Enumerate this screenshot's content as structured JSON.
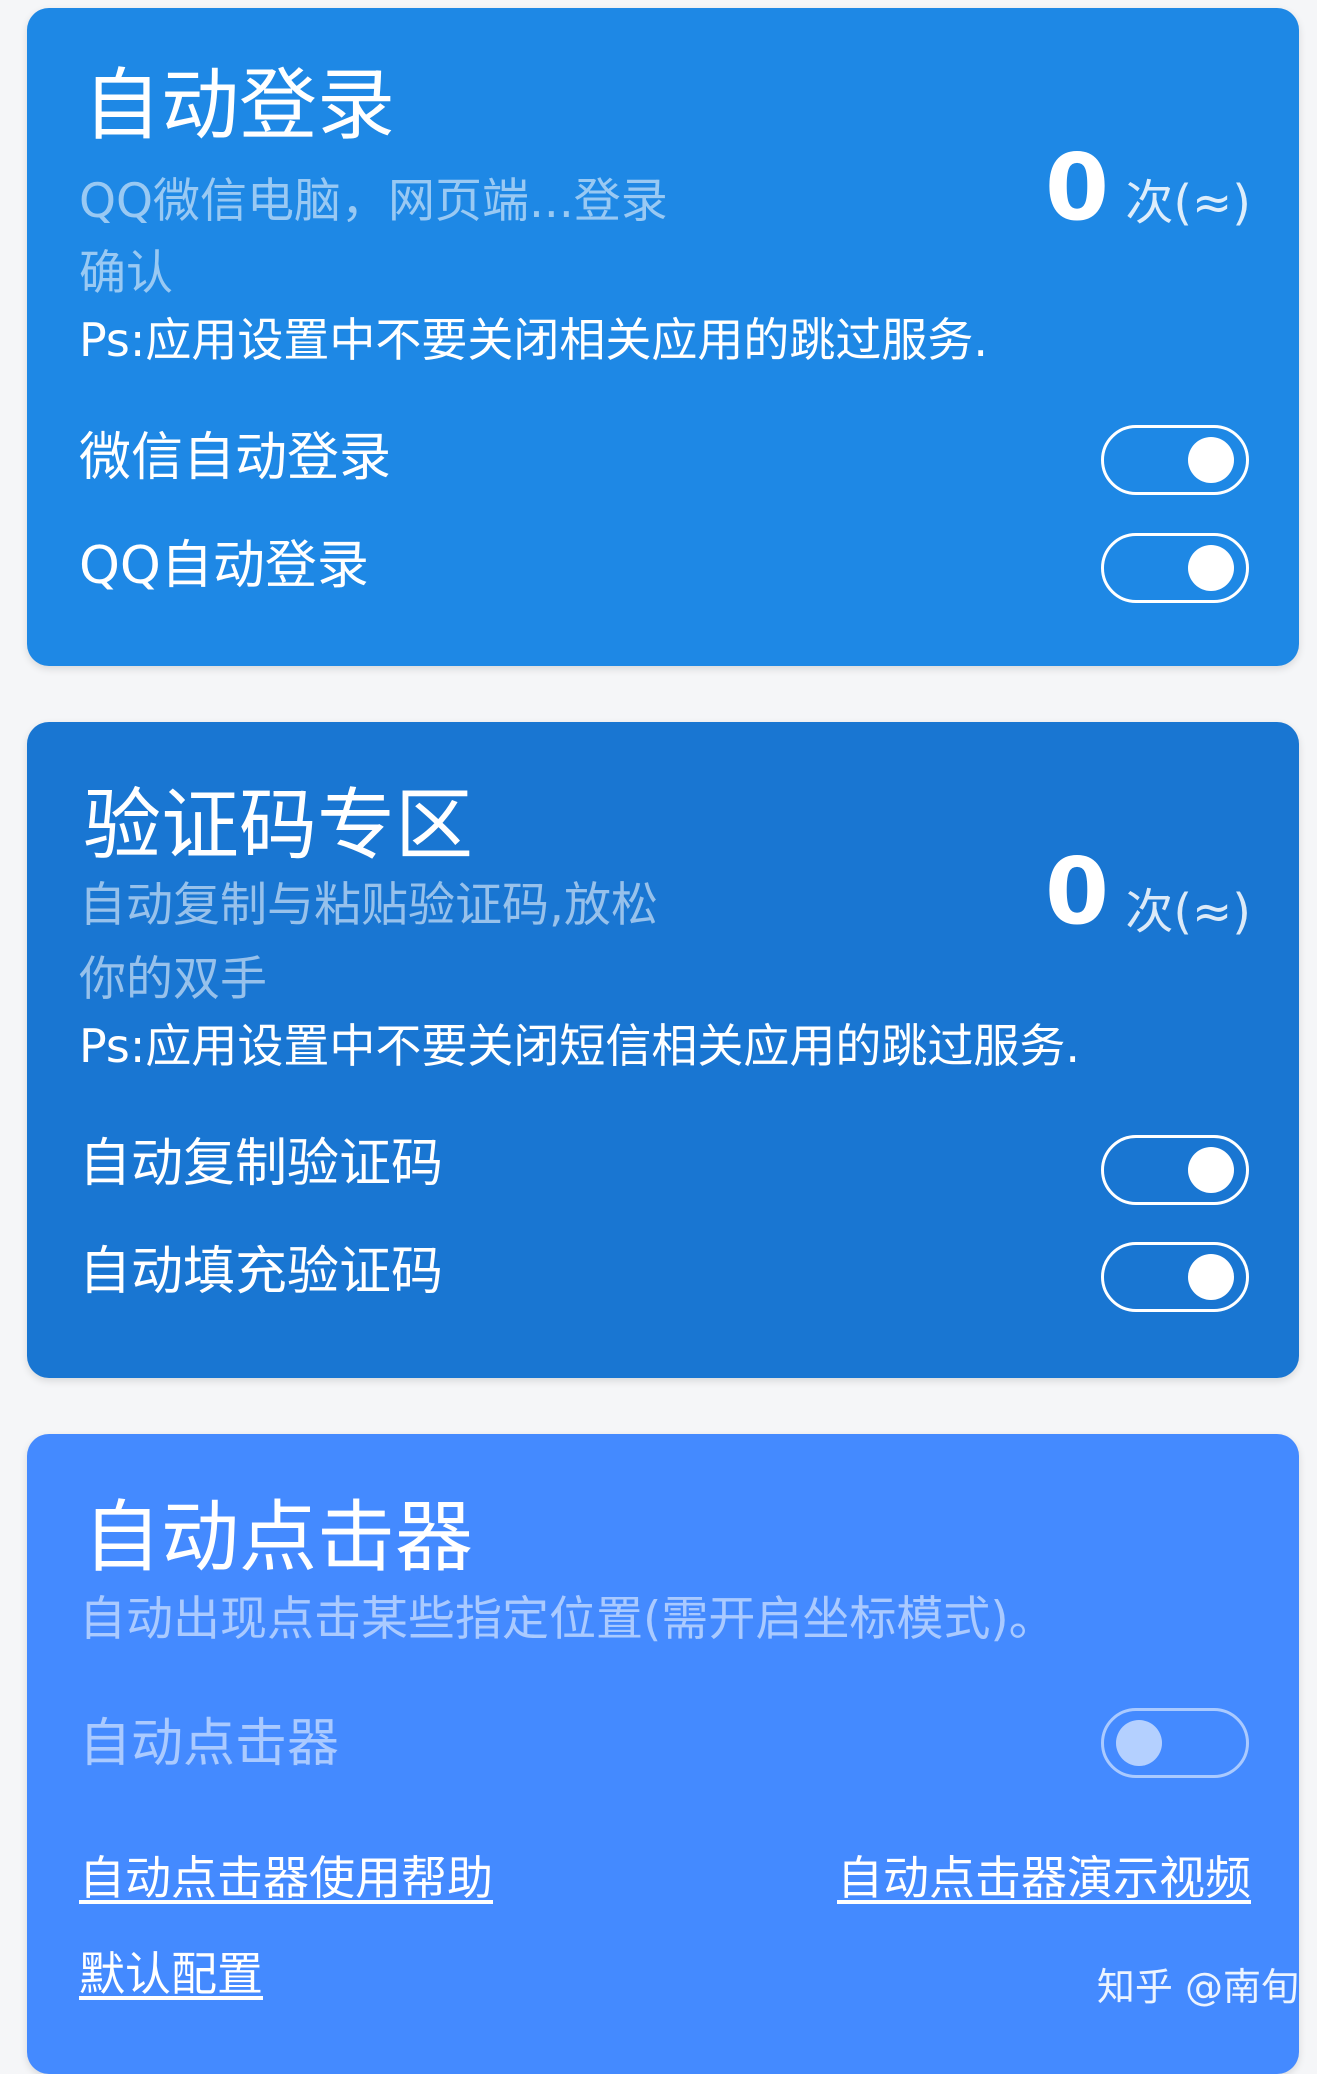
{
  "login": {
    "title": "自动登录",
    "subtitle_line1": "QQ微信电脑，网页端...登录",
    "subtitle_line2": "确认",
    "count": "0",
    "count_unit": "次(≈)",
    "note": "Ps:应用设置中不要关闭相关应用的跳过服务.",
    "toggles": [
      {
        "label": "微信自动登录",
        "state": "on"
      },
      {
        "label": "QQ自动登录",
        "state": "on"
      }
    ]
  },
  "captcha": {
    "title": "验证码专区",
    "subtitle_line1": "自动复制与粘贴验证码,放松",
    "subtitle_line2": "你的双手",
    "count": "0",
    "count_unit": "次(≈)",
    "note": "Ps:应用设置中不要关闭短信相关应用的跳过服务.",
    "toggles": [
      {
        "label": "自动复制验证码",
        "state": "on"
      },
      {
        "label": "自动填充验证码",
        "state": "on"
      }
    ]
  },
  "clicker": {
    "title": "自动点击器",
    "subtitle": "自动出现点击某些指定位置(需开启坐标模式)。",
    "toggle": {
      "label": "自动点击器",
      "state": "off"
    },
    "link_help": "自动点击器使用帮助",
    "link_demo": "自动点击器演示视频",
    "link_default": "默认配置"
  },
  "watermark": "知乎 @南旬",
  "colors": {
    "card_login": "#1e88e5",
    "card_captcha": "#1976d2",
    "card_clicker": "#448aff",
    "page_bg": "#f5f6f8"
  }
}
